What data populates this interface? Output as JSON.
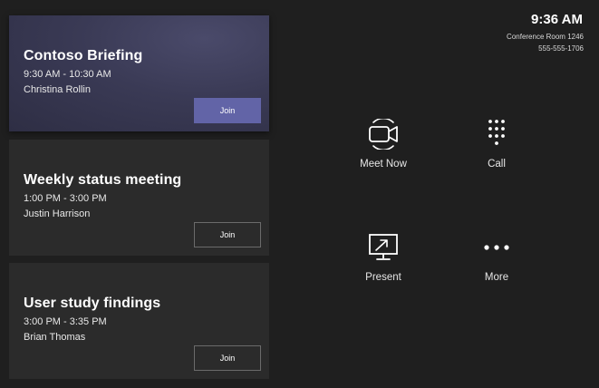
{
  "meetings": [
    {
      "title": "Contoso Briefing",
      "time": "9:30 AM - 10:30 AM",
      "organizer": "Christina Rollin",
      "join_label": "Join"
    },
    {
      "title": "Weekly status meeting",
      "time": "1:00 PM - 3:00 PM",
      "organizer": "Justin Harrison",
      "join_label": "Join"
    },
    {
      "title": "User study findings",
      "time": "3:00 PM - 3:35 PM",
      "organizer": "Brian Thomas",
      "join_label": "Join"
    }
  ],
  "status": {
    "clock": "9:36 AM",
    "room": "Conference Room 1246",
    "phone": "555-555-1706"
  },
  "actions": {
    "meet_now": {
      "label": "Meet Now",
      "icon": "video-camera-icon"
    },
    "call": {
      "label": "Call",
      "icon": "dialpad-icon"
    },
    "present": {
      "label": "Present",
      "icon": "present-screen-icon"
    },
    "more": {
      "label": "More",
      "icon": "more-dots-icon"
    }
  },
  "colors": {
    "background": "#1f1f1f",
    "card": "#2b2b2b",
    "featured_card": "#3a3a55",
    "accent": "#6264a7"
  }
}
